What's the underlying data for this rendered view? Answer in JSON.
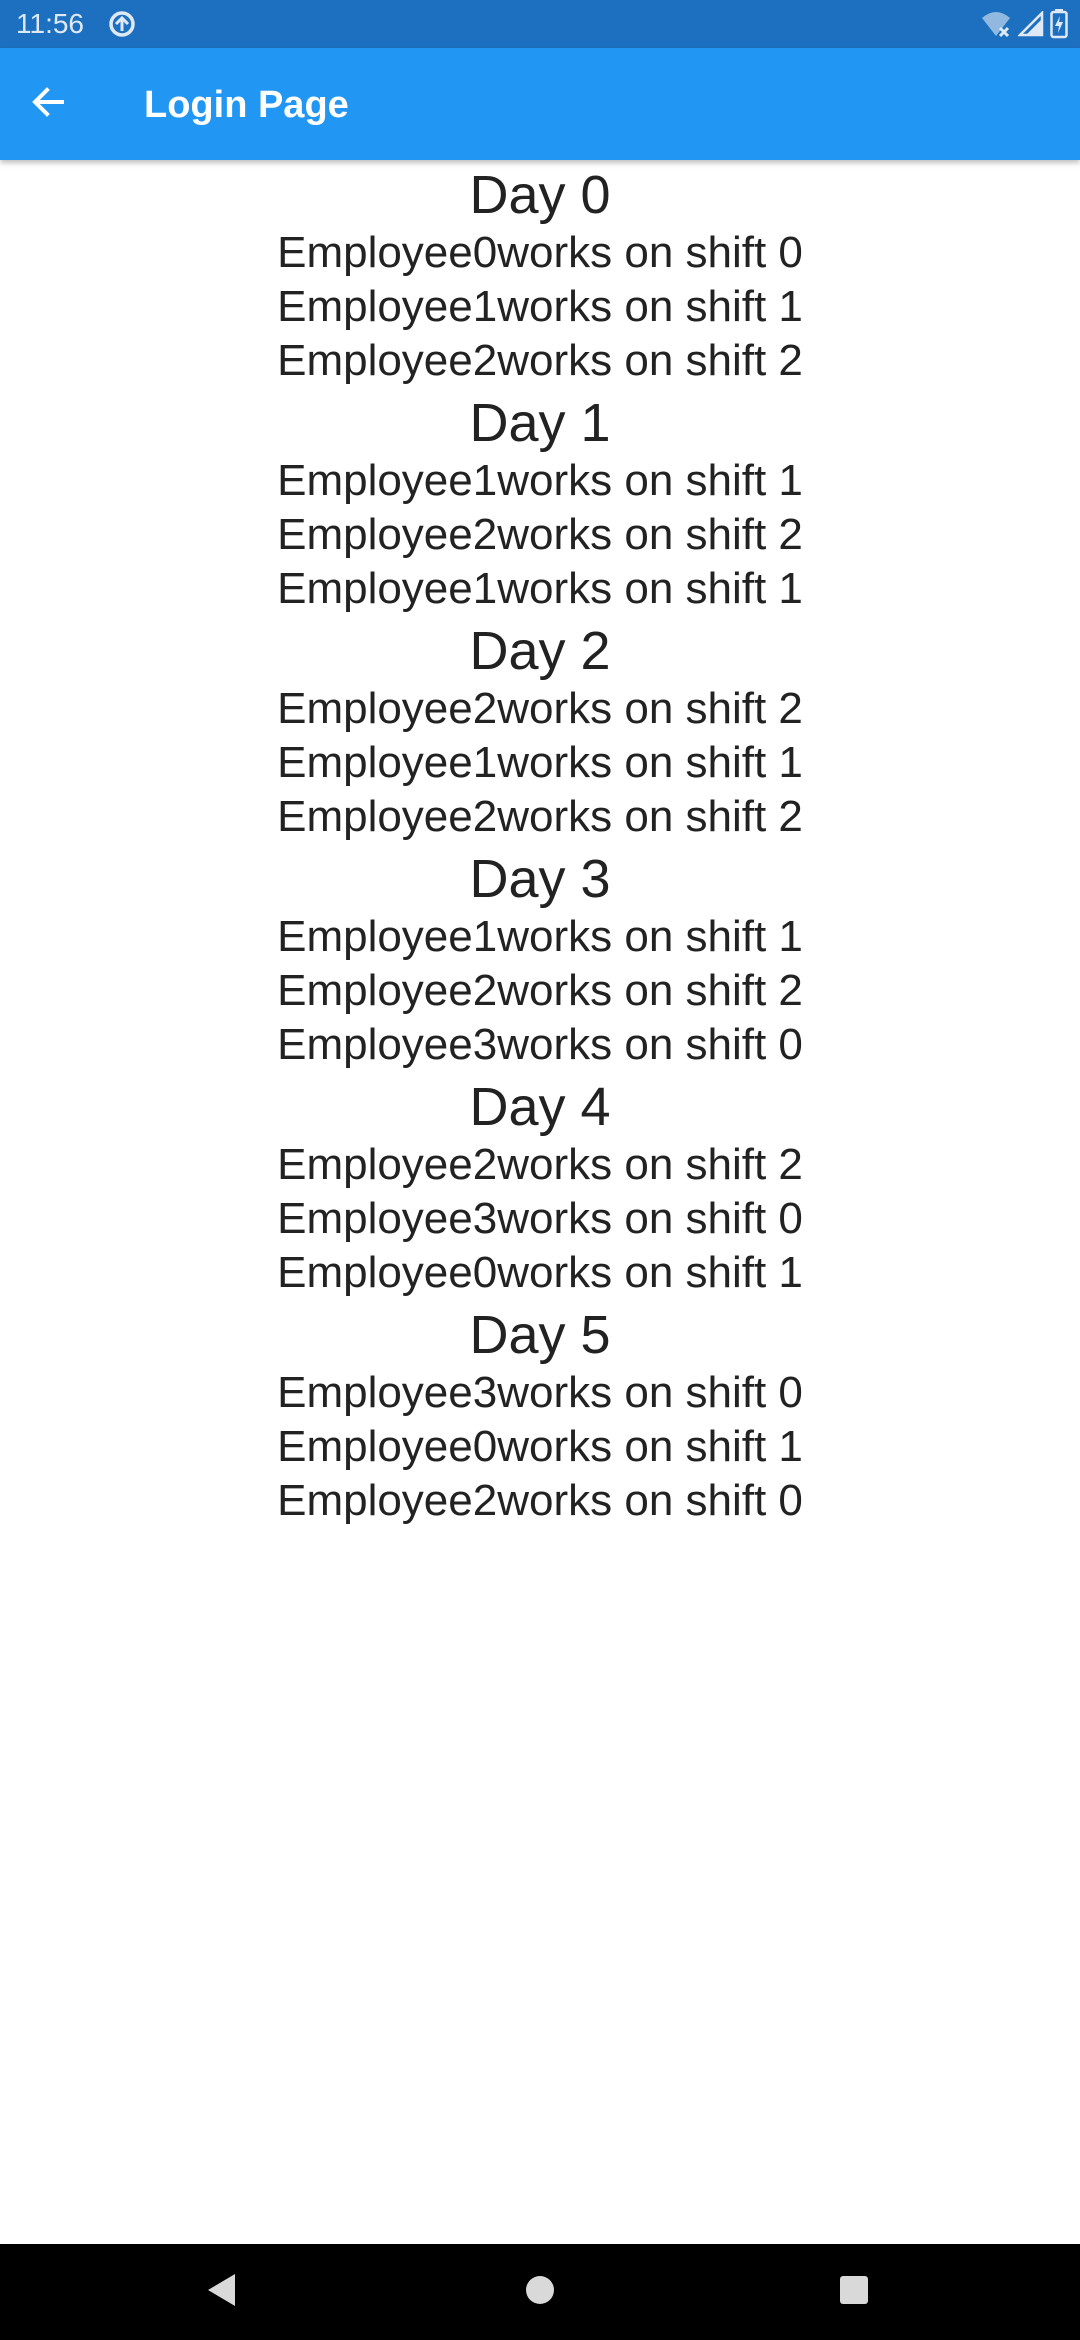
{
  "status_bar": {
    "time": "11:56"
  },
  "app_bar": {
    "title": "Login Page"
  },
  "schedule": [
    {
      "day": "Day 0",
      "shifts": [
        "Employee0works on shift 0",
        "Employee1works on shift 1",
        "Employee2works on shift 2"
      ]
    },
    {
      "day": "Day 1",
      "shifts": [
        "Employee1works on shift 1",
        "Employee2works on shift 2",
        "Employee1works on shift 1"
      ]
    },
    {
      "day": "Day 2",
      "shifts": [
        "Employee2works on shift 2",
        "Employee1works on shift 1",
        "Employee2works on shift 2"
      ]
    },
    {
      "day": "Day 3",
      "shifts": [
        "Employee1works on shift 1",
        "Employee2works on shift 2",
        "Employee3works on shift 0"
      ]
    },
    {
      "day": "Day 4",
      "shifts": [
        "Employee2works on shift 2",
        "Employee3works on shift 0",
        "Employee0works on shift 1"
      ]
    },
    {
      "day": "Day 5",
      "shifts": [
        "Employee3works on shift 0",
        "Employee0works on shift 1",
        "Employee2works on shift 0"
      ]
    }
  ],
  "icons": {
    "back": "arrow-back-icon",
    "status_left": "data-saver-icon",
    "wifi": "wifi-off-icon",
    "signal": "cell-signal-icon",
    "battery": "battery-charging-icon",
    "nav_back": "nav-back-icon",
    "nav_home": "nav-home-icon",
    "nav_recents": "nav-recents-icon"
  },
  "colors": {
    "status_bar": "#1d6fbf",
    "app_bar": "#2196f3",
    "text": "#222222",
    "nav_bar": "#000000"
  }
}
